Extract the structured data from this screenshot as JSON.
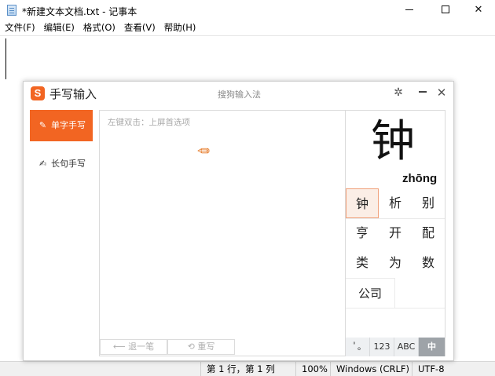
{
  "window": {
    "title": "*新建文本文档.txt - 记事本",
    "min_glyph": "",
    "close_glyph": "✕"
  },
  "menu": [
    {
      "label": "文件(F)"
    },
    {
      "label": "编辑(E)"
    },
    {
      "label": "格式(O)"
    },
    {
      "label": "查看(V)"
    },
    {
      "label": "帮助(H)"
    }
  ],
  "status": {
    "position": "第 1 行，第 1 列",
    "zoom": "100%",
    "line_ending": "Windows (CRLF)",
    "encoding": "UTF-8"
  },
  "handwriting": {
    "logo_glyph": "S",
    "title": "手写输入",
    "brand": "搜狗输入法",
    "gear_glyph": "✲",
    "close_glyph": "✕",
    "modes": [
      {
        "label": "单字手写",
        "icon": "✎",
        "active": true
      },
      {
        "label": "长句手写",
        "icon": "✍",
        "active": false
      }
    ],
    "canvas_hint": "左键双击：上屏首选项",
    "pencil_glyph": "✏",
    "undo_label": "⟵ 退一笔",
    "rewrite_label": "⟲ 重写",
    "preview_char": "钟",
    "preview_pinyin": "zhōng",
    "candidates": [
      "钟",
      "析",
      "别",
      "亨",
      "开",
      "配",
      "类",
      "为",
      "数"
    ],
    "phrase_candidate": "公司",
    "keyboards": [
      {
        "label": "ﾟ｡",
        "active": false
      },
      {
        "label": "123",
        "active": false
      },
      {
        "label": "ABC",
        "active": false
      },
      {
        "label": "中",
        "active": true
      }
    ],
    "accent_color": "#f26522"
  }
}
